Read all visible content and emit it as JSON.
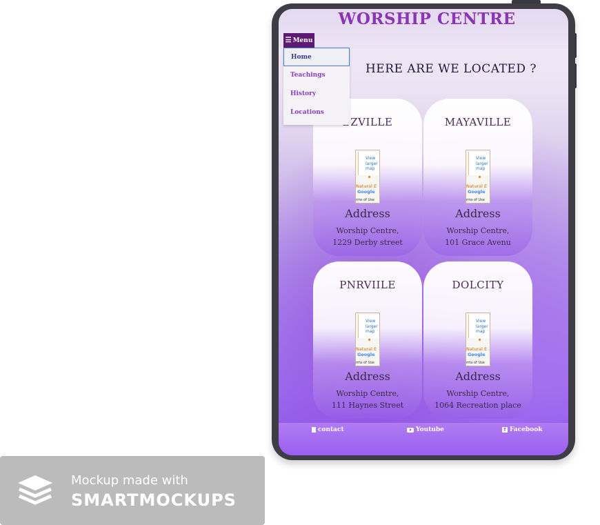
{
  "site": {
    "title": "WORSHIP CENTRE"
  },
  "menu": {
    "button_label": "Menu",
    "items": [
      {
        "label": "Home",
        "active": true
      },
      {
        "label": "Teachings"
      },
      {
        "label": "History"
      },
      {
        "label": "Locations"
      }
    ]
  },
  "section": {
    "title": "HERE ARE WE LOCATED ?"
  },
  "locations": [
    {
      "city": "BZVILLE",
      "address_label": "Address",
      "line1": "Worship Centre,",
      "line2": "1229 Derby street"
    },
    {
      "city": "MAYAVILLE",
      "address_label": "Address",
      "line1": "Worship Centre,",
      "line2": "101 Grace Avenu"
    },
    {
      "city": "PNRVIILE",
      "address_label": "Address",
      "line1": "Worship Centre,",
      "line2": "111 Haynes Street"
    },
    {
      "city": "DOLCITY",
      "address_label": "Address",
      "line1": "Worship Centre,",
      "line2": "1064 Recreation place"
    }
  ],
  "map_thumb": {
    "link": "View larger map",
    "natural": "Natural E",
    "google": "Google",
    "terms": "rms of Use"
  },
  "footer": {
    "contact": "contact",
    "youtube": "Youtube",
    "facebook": "Facebook"
  },
  "watermark": {
    "line1": "Mockup made with",
    "line2": "SMARTMOCKUPS"
  },
  "colors": {
    "accent": "#8a35b5",
    "menu_bg": "#5c1a72",
    "footer_bg": "#9a5ff1",
    "device_frame": "#3e3d45"
  }
}
